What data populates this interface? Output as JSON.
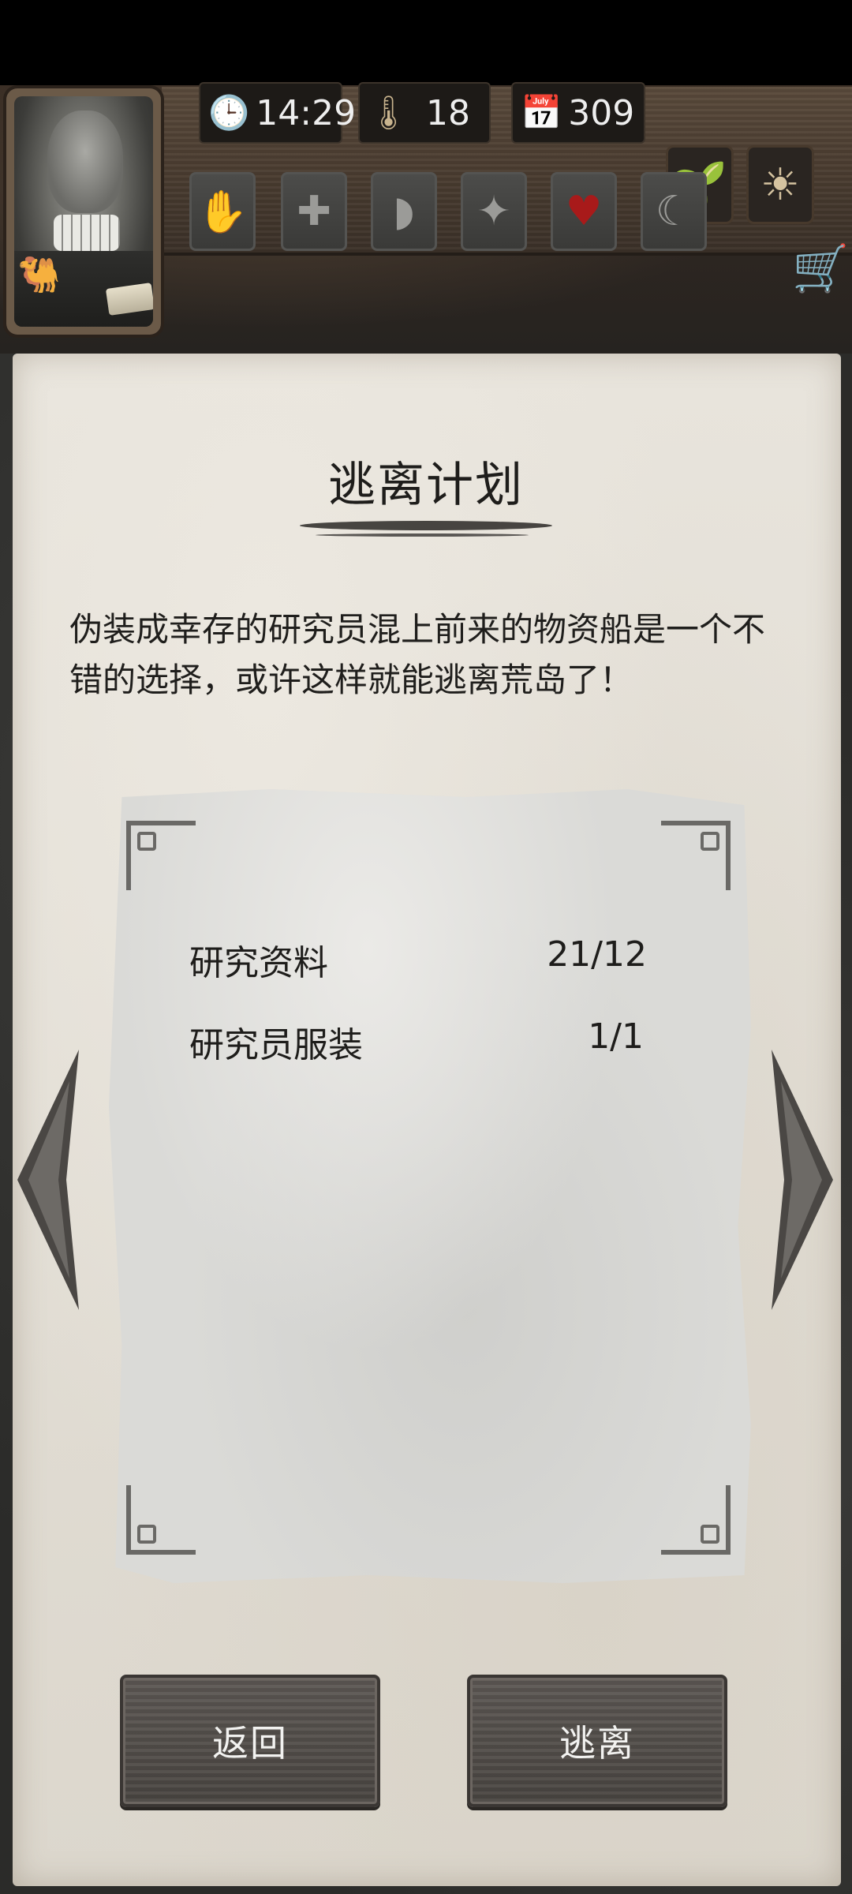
{
  "hud": {
    "time": "14:29",
    "temperature": "18",
    "day_count": "309",
    "icons": {
      "clock": "clock-icon",
      "temperature": "thermometer-icon",
      "calendar": "calendar-icon",
      "sprout": "sprout-icon",
      "weather": "sun-icon",
      "cart": "shopping-cart-icon"
    },
    "condition_icons": [
      "hand-bandage-icon",
      "medical-cross-icon",
      "stomach-icon",
      "head-dizzy-icon",
      "heart-icon",
      "moon-star-icon"
    ],
    "active_condition_color": "#a81a1a"
  },
  "dialog": {
    "title": "逃离计划",
    "description": "伪装成幸存的研究员混上前来的物资船是一个不错的选择，或许这样就能逃离荒岛了！",
    "requirements": [
      {
        "name": "研究资料",
        "value": "21/12"
      },
      {
        "name": "研究员服装",
        "value": "1/1"
      }
    ]
  },
  "buttons": {
    "back_label": "返回",
    "escape_label": "逃离"
  }
}
